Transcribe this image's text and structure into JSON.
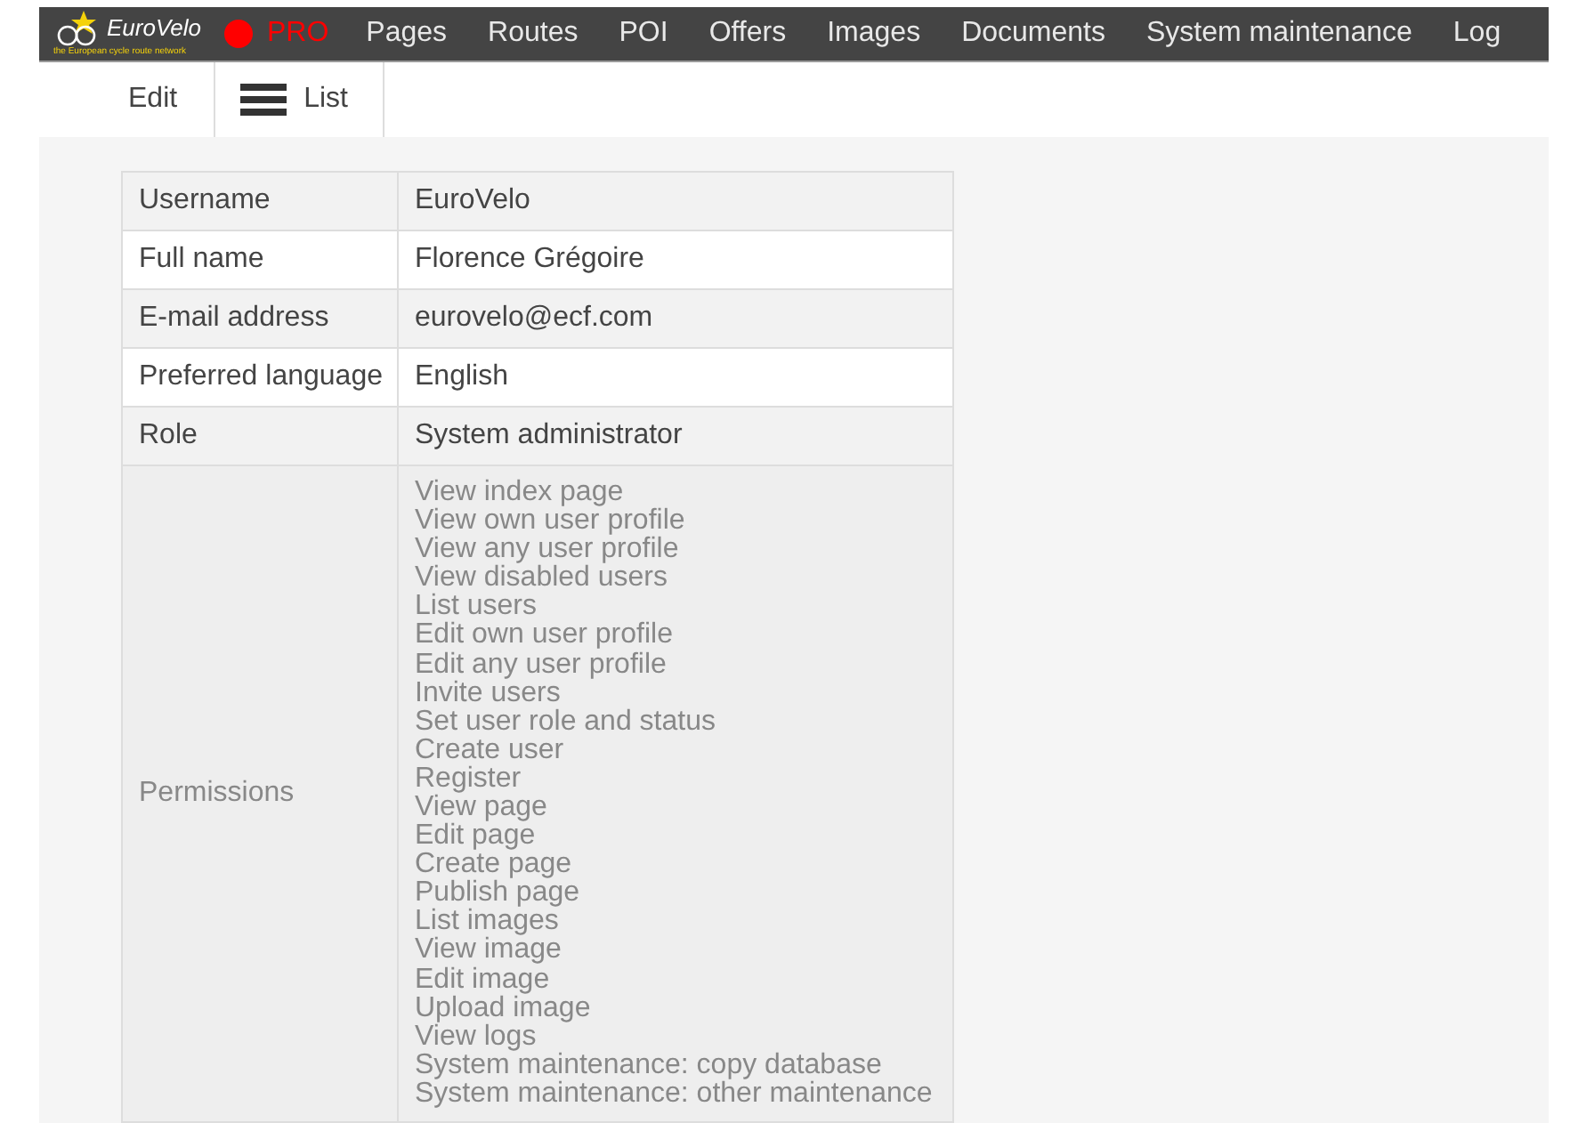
{
  "logo": {
    "name": "EuroVelo",
    "tagline": "the European cycle route network"
  },
  "mode": {
    "label": "PRO",
    "color": "#ff0000"
  },
  "nav": [
    "Pages",
    "Routes",
    "POI",
    "Offers",
    "Images",
    "Documents",
    "System maintenance",
    "Log"
  ],
  "tabs": [
    {
      "label": "Edit",
      "kind": "text"
    },
    {
      "label": "List",
      "kind": "icon"
    }
  ],
  "table": {
    "rows": [
      {
        "label": "Username",
        "value": "EuroVelo",
        "muted": false
      },
      {
        "label": "Full name",
        "value": "Florence Grégoire",
        "muted": false
      },
      {
        "label": "E-mail address",
        "value": "eurovelo@ecf.com",
        "muted": false
      },
      {
        "label": "Preferred language",
        "value": "English",
        "muted": false
      },
      {
        "label": "Role",
        "value": "System administrator",
        "muted": false
      }
    ],
    "permissions": {
      "label": "Permissions",
      "muted": true,
      "items": [
        "View index page",
        "View own user profile",
        "View any user profile",
        "View disabled users",
        "List users",
        "Edit own user profile",
        "Edit any user profile",
        "Invite users",
        "Set user role and status",
        "Create user",
        "Register",
        "View page",
        "Edit page",
        "Create page",
        "Publish page",
        "List images",
        "View image",
        "Edit image",
        "Upload image",
        "View logs",
        "System maintenance: copy database",
        "System maintenance: other maintenance"
      ]
    }
  }
}
